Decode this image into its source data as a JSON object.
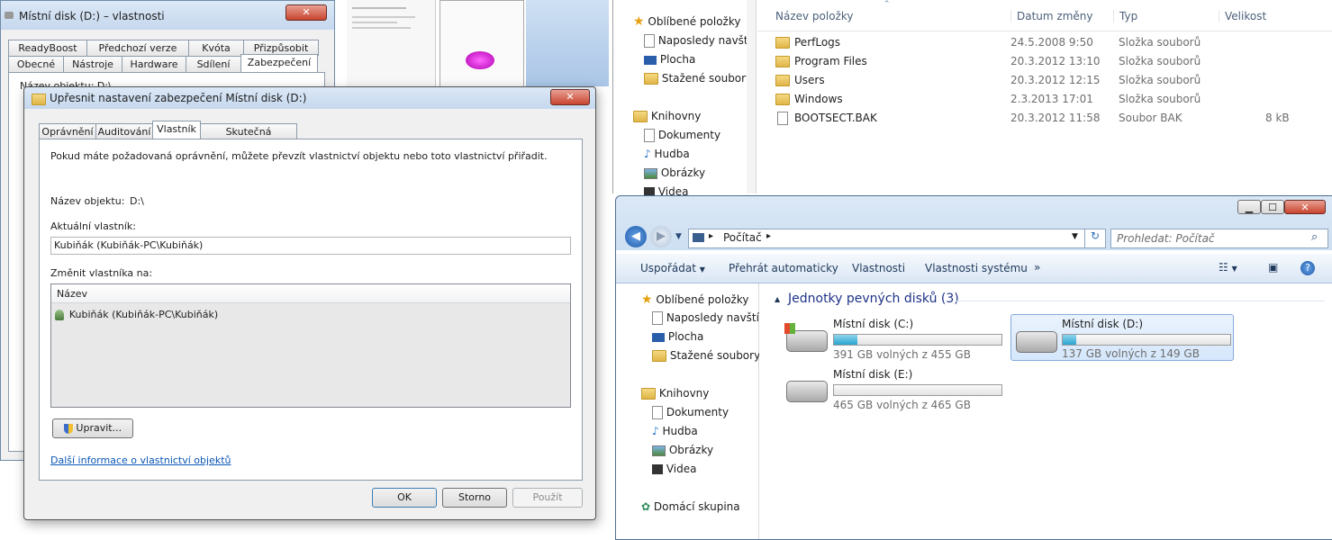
{
  "props_window": {
    "title": "Místní disk (D:) – vlastnosti",
    "tabs_row1": [
      "ReadyBoost",
      "Předchozí verze",
      "Kvóta",
      "Přizpůsobit"
    ],
    "tabs_row2": [
      "Obecné",
      "Nástroje",
      "Hardware",
      "Sdílení",
      "Zabezpečení"
    ],
    "object_label": "Název objektu:  D:\\"
  },
  "adv_dialog": {
    "title": "Upřesnit nastavení zabezpečení Místní disk (D:)",
    "tabs": [
      "Oprávnění",
      "Auditování",
      "Vlastník",
      "Skutečná oprávnění"
    ],
    "info_text": "Pokud máte požadovaná oprávnění, můžete převzít vlastnictví objektu nebo toto vlastnictví přiřadit.",
    "object_name_label": "Název objektu:",
    "object_name_value": "D:\\",
    "current_owner_label": "Aktuální vlastník:",
    "current_owner_value": "Kubiňák (Kubiňák-PC\\Kubiňák)",
    "change_owner_label": "Změnit vlastníka na:",
    "list_header": "Název",
    "list_items": [
      "Kubiňák (Kubiňák-PC\\Kubiňák)"
    ],
    "edit_button": "Upravit...",
    "more_info_link": "Další informace o vlastnictví objektů",
    "ok_button": "OK",
    "cancel_button": "Storno",
    "apply_button": "Použít"
  },
  "explorer_top": {
    "columns": [
      "Název položky",
      "Datum změny",
      "Typ",
      "Velikost"
    ],
    "nav": [
      "Oblíbené položky",
      "Naposledy navští",
      "Plocha",
      "Stažené soubory",
      "Knihovny",
      "Dokumenty",
      "Hudba",
      "Obrázky",
      "Videa"
    ],
    "files": [
      {
        "name": "PerfLogs",
        "date": "24.5.2008 9:50",
        "type": "Složka souborů",
        "size": ""
      },
      {
        "name": "Program Files",
        "date": "20.3.2012 13:10",
        "type": "Složka souborů",
        "size": ""
      },
      {
        "name": "Users",
        "date": "20.3.2012 12:15",
        "type": "Složka souborů",
        "size": ""
      },
      {
        "name": "Windows",
        "date": "2.3.2013 17:01",
        "type": "Složka souborů",
        "size": ""
      },
      {
        "name": "BOOTSECT.BAK",
        "date": "20.3.2012 11:58",
        "type": "Soubor BAK",
        "size": "8 kB"
      }
    ]
  },
  "explorer_main": {
    "breadcrumb": "Počítač",
    "search_placeholder": "Prohledat: Počítač",
    "toolbar": [
      "Uspořádat",
      "Přehrát automaticky",
      "Vlastnosti",
      "Vlastnosti systému",
      "»"
    ],
    "nav": [
      "Oblíbené položky",
      "Naposledy navští",
      "Plocha",
      "Stažené soubory",
      "Knihovny",
      "Dokumenty",
      "Hudba",
      "Obrázky",
      "Videa",
      "Domácí skupina"
    ],
    "group_title": "Jednotky pevných disků (3)",
    "drives": [
      {
        "name": "Místní disk (C:)",
        "free": "391 GB volných z 455 GB",
        "used_fraction": 0.14
      },
      {
        "name": "Místní disk (D:)",
        "free": "137 GB volných z 149 GB",
        "used_fraction": 0.08
      },
      {
        "name": "Místní disk (E:)",
        "free": "465 GB volných z 465 GB",
        "used_fraction": 0.0
      }
    ]
  }
}
